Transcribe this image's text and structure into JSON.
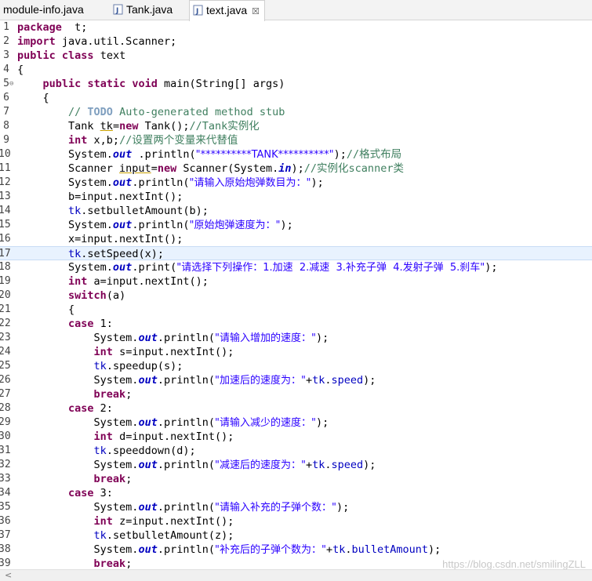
{
  "tabs": [
    {
      "label": "module-info.java",
      "has_icon": false
    },
    {
      "label": "Tank.java",
      "has_icon": true
    },
    {
      "label": "text.java",
      "has_icon": true,
      "active": true,
      "close": "☒"
    }
  ],
  "current_line": 17,
  "lines": [
    {
      "n": "1",
      "t": [
        [
          "kw",
          "package"
        ],
        [
          "",
          "  t;"
        ]
      ]
    },
    {
      "n": "2",
      "t": [
        [
          "kw",
          "import"
        ],
        [
          "",
          " java.util.Scanner;"
        ]
      ]
    },
    {
      "n": "3",
      "t": [
        [
          "kw",
          "public"
        ],
        [
          "",
          " "
        ],
        [
          "kw",
          "class"
        ],
        [
          "",
          " text"
        ]
      ]
    },
    {
      "n": "4",
      "t": [
        [
          "",
          "{"
        ]
      ]
    },
    {
      "n": "5",
      "fold": "⊖",
      "t": [
        [
          "",
          "    "
        ],
        [
          "kw",
          "public"
        ],
        [
          "",
          " "
        ],
        [
          "kw",
          "static"
        ],
        [
          "",
          " "
        ],
        [
          "kw",
          "void"
        ],
        [
          "",
          " main(String[] args)"
        ]
      ]
    },
    {
      "n": "6",
      "t": [
        [
          "",
          "    {"
        ]
      ]
    },
    {
      "n": "7",
      "t": [
        [
          "",
          "        "
        ],
        [
          "cm",
          "// "
        ],
        [
          "todo",
          "TODO"
        ],
        [
          "cm",
          " Auto-generated method stub"
        ]
      ]
    },
    {
      "n": "8",
      "t": [
        [
          "",
          "        Tank "
        ],
        [
          "unused",
          "tk"
        ],
        [
          "",
          "="
        ],
        [
          "kw",
          "new"
        ],
        [
          "",
          " Tank();"
        ],
        [
          "cm",
          "//Tank实例化"
        ]
      ]
    },
    {
      "n": "9",
      "t": [
        [
          "",
          "        "
        ],
        [
          "kw",
          "int"
        ],
        [
          "",
          " x,b;"
        ],
        [
          "cm",
          "//设置两个变量来代替值"
        ]
      ]
    },
    {
      "n": "10",
      "t": [
        [
          "",
          "        System."
        ],
        [
          "sfld",
          "out"
        ],
        [
          "",
          " .println("
        ],
        [
          "str",
          "\"**********TANK**********\""
        ],
        [
          "",
          ");"
        ],
        [
          "cm",
          "//格式布局"
        ]
      ]
    },
    {
      "n": "11",
      "t": [
        [
          "",
          "        Scanner "
        ],
        [
          "unused",
          "input"
        ],
        [
          "",
          "="
        ],
        [
          "kw",
          "new"
        ],
        [
          "",
          " Scanner(System."
        ],
        [
          "sfld",
          "in"
        ],
        [
          "",
          ");"
        ],
        [
          "cm",
          "//实例化scanner类"
        ]
      ]
    },
    {
      "n": "12",
      "t": [
        [
          "",
          "        System."
        ],
        [
          "sfld",
          "out"
        ],
        [
          "",
          ".println("
        ],
        [
          "str",
          "\"请输入原始炮弹数目为：\""
        ],
        [
          "",
          ");"
        ]
      ]
    },
    {
      "n": "13",
      "t": [
        [
          "",
          "        b=input.nextInt();"
        ]
      ]
    },
    {
      "n": "14",
      "t": [
        [
          "",
          "        "
        ],
        [
          "fld",
          "tk"
        ],
        [
          "",
          ".setbulletAmount(b);"
        ]
      ]
    },
    {
      "n": "15",
      "t": [
        [
          "",
          "        System."
        ],
        [
          "sfld",
          "out"
        ],
        [
          "",
          ".println("
        ],
        [
          "str",
          "\"原始炮弹速度为：\""
        ],
        [
          "",
          ");"
        ]
      ]
    },
    {
      "n": "16",
      "t": [
        [
          "",
          "        x=input.nextInt();"
        ]
      ]
    },
    {
      "n": "17",
      "t": [
        [
          "",
          "        "
        ],
        [
          "fld",
          "tk"
        ],
        [
          "",
          ".setSpeed(x);"
        ]
      ]
    },
    {
      "n": "18",
      "t": [
        [
          "",
          "        System."
        ],
        [
          "sfld",
          "out"
        ],
        [
          "",
          ".print("
        ],
        [
          "str",
          "\"请选择下列操作：1.加速  2.减速  3.补充子弹  4.发射子弹  5.刹车\""
        ],
        [
          "",
          ");"
        ]
      ]
    },
    {
      "n": "19",
      "t": [
        [
          "",
          "        "
        ],
        [
          "kw",
          "int"
        ],
        [
          "",
          " a=input.nextInt();"
        ]
      ]
    },
    {
      "n": "20",
      "t": [
        [
          "",
          "        "
        ],
        [
          "kw",
          "switch"
        ],
        [
          "",
          "(a)"
        ]
      ]
    },
    {
      "n": "21",
      "t": [
        [
          "",
          "        {"
        ]
      ]
    },
    {
      "n": "22",
      "t": [
        [
          "",
          "        "
        ],
        [
          "kw",
          "case"
        ],
        [
          "",
          " 1:"
        ]
      ]
    },
    {
      "n": "23",
      "t": [
        [
          "",
          "            System."
        ],
        [
          "sfld",
          "out"
        ],
        [
          "",
          ".println("
        ],
        [
          "str",
          "\"请输入增加的速度：\""
        ],
        [
          "",
          ");"
        ]
      ]
    },
    {
      "n": "24",
      "t": [
        [
          "",
          "            "
        ],
        [
          "kw",
          "int"
        ],
        [
          "",
          " s=input.nextInt();"
        ]
      ]
    },
    {
      "n": "25",
      "t": [
        [
          "",
          "            "
        ],
        [
          "fld",
          "tk"
        ],
        [
          "",
          ".speedup(s);"
        ]
      ]
    },
    {
      "n": "26",
      "t": [
        [
          "",
          "            System."
        ],
        [
          "sfld",
          "out"
        ],
        [
          "",
          ".println("
        ],
        [
          "str",
          "\"加速后的速度为：\""
        ],
        [
          "",
          "+"
        ],
        [
          "fld",
          "tk"
        ],
        [
          "",
          "."
        ],
        [
          "fld",
          "speed"
        ],
        [
          "",
          ");"
        ]
      ]
    },
    {
      "n": "27",
      "t": [
        [
          "",
          "            "
        ],
        [
          "kw",
          "break"
        ],
        [
          "",
          ";"
        ]
      ]
    },
    {
      "n": "28",
      "t": [
        [
          "",
          "        "
        ],
        [
          "kw",
          "case"
        ],
        [
          "",
          " 2:"
        ]
      ]
    },
    {
      "n": "29",
      "t": [
        [
          "",
          "            System."
        ],
        [
          "sfld",
          "out"
        ],
        [
          "",
          ".println("
        ],
        [
          "str",
          "\"请输入减少的速度：\""
        ],
        [
          "",
          ");"
        ]
      ]
    },
    {
      "n": "30",
      "t": [
        [
          "",
          "            "
        ],
        [
          "kw",
          "int"
        ],
        [
          "",
          " d=input.nextInt();"
        ]
      ]
    },
    {
      "n": "31",
      "t": [
        [
          "",
          "            "
        ],
        [
          "fld",
          "tk"
        ],
        [
          "",
          ".speeddown(d);"
        ]
      ]
    },
    {
      "n": "32",
      "t": [
        [
          "",
          "            System."
        ],
        [
          "sfld",
          "out"
        ],
        [
          "",
          ".println("
        ],
        [
          "str",
          "\"减速后的速度为：\""
        ],
        [
          "",
          "+"
        ],
        [
          "fld",
          "tk"
        ],
        [
          "",
          "."
        ],
        [
          "fld",
          "speed"
        ],
        [
          "",
          ");"
        ]
      ]
    },
    {
      "n": "33",
      "t": [
        [
          "",
          "            "
        ],
        [
          "kw",
          "break"
        ],
        [
          "",
          ";"
        ]
      ]
    },
    {
      "n": "34",
      "t": [
        [
          "",
          "        "
        ],
        [
          "kw",
          "case"
        ],
        [
          "",
          " 3:"
        ]
      ]
    },
    {
      "n": "35",
      "t": [
        [
          "",
          "            System."
        ],
        [
          "sfld",
          "out"
        ],
        [
          "",
          ".println("
        ],
        [
          "str",
          "\"请输入补充的子弹个数：\""
        ],
        [
          "",
          ");"
        ]
      ]
    },
    {
      "n": "36",
      "t": [
        [
          "",
          "            "
        ],
        [
          "kw",
          "int"
        ],
        [
          "",
          " z=input.nextInt();"
        ]
      ]
    },
    {
      "n": "37",
      "t": [
        [
          "",
          "            "
        ],
        [
          "fld",
          "tk"
        ],
        [
          "",
          ".setbulletAmount(z);"
        ]
      ]
    },
    {
      "n": "38",
      "t": [
        [
          "",
          "            System."
        ],
        [
          "sfld",
          "out"
        ],
        [
          "",
          ".println("
        ],
        [
          "str",
          "\"补充后的子弹个数为：\""
        ],
        [
          "",
          "+"
        ],
        [
          "fld",
          "tk"
        ],
        [
          "",
          "."
        ],
        [
          "fld",
          "bulletAmount"
        ],
        [
          "",
          ");"
        ]
      ]
    },
    {
      "n": "39",
      "t": [
        [
          "",
          "            "
        ],
        [
          "kw",
          "break"
        ],
        [
          "",
          ";"
        ]
      ]
    }
  ],
  "watermark": "https://blog.csdn.net/smilingZLL",
  "scroll_left": "<"
}
